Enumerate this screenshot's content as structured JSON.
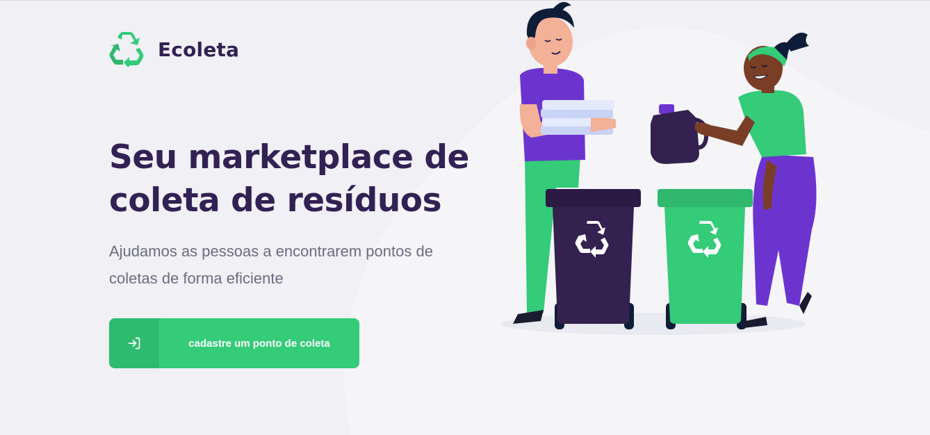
{
  "app": {
    "brand_name": "Ecoleta",
    "logo_icon": "recycle-icon"
  },
  "hero": {
    "title": "Seu marketplace de coleta de resíduos",
    "subtitle": "Ajudamos as pessoas a encontrarem pontos de coletas de forma eficiente"
  },
  "cta": {
    "label": "cadastre um ponto de coleta",
    "icon": "log-in-icon"
  },
  "colors": {
    "background": "#F0F0F5",
    "primary": "#34CB79",
    "title": "#322153",
    "text": "#6C6C80",
    "accent_purple": "#6C34CF"
  }
}
